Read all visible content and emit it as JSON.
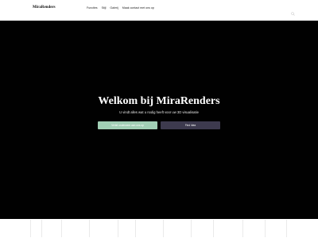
{
  "header": {
    "logo": "MiraRenders",
    "nav": [
      "Functies",
      "Stijl",
      "Galerij",
      "Maak contact met ons op"
    ],
    "search_icon": "search-icon"
  },
  "hero": {
    "title": "Welkom bij MiraRenders",
    "subtitle": "U vindt alles wat u nodig heeft voor uw 3D visualisatie",
    "primary_button": "Vertel onderweer aan ons op",
    "secondary_button": "Find Idea"
  },
  "colors": {
    "hero_background": "#010101",
    "primary_button": "#a1cfb5",
    "secondary_button": "#3d3a4e"
  }
}
